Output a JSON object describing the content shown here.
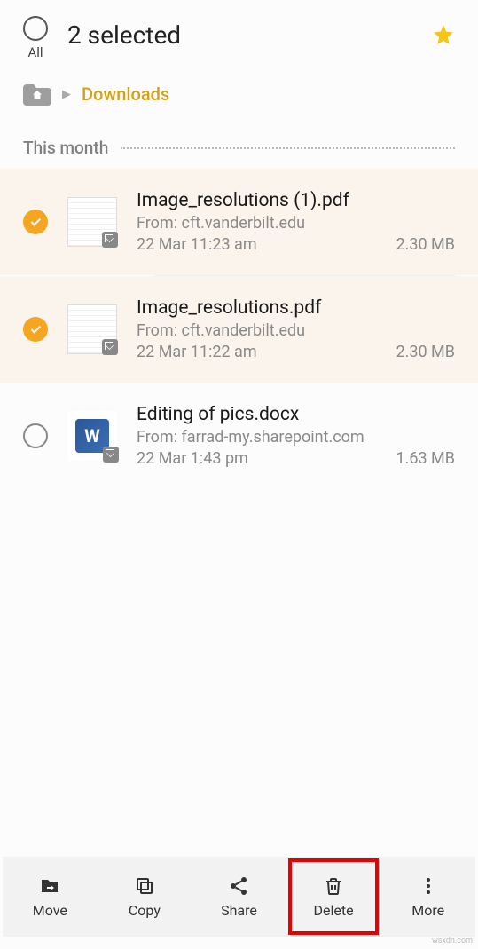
{
  "header": {
    "title": "2 selected",
    "select_all_label": "All"
  },
  "breadcrumb": {
    "current": "Downloads"
  },
  "section": {
    "title": "This month"
  },
  "files": [
    {
      "name": "Image_resolutions (1).pdf",
      "from": "From: cft.vanderbilt.edu",
      "date": "22 Mar 11:23 am",
      "size": "2.30 MB",
      "selected": true,
      "type": "pdf"
    },
    {
      "name": "Image_resolutions.pdf",
      "from": "From: cft.vanderbilt.edu",
      "date": "22 Mar 11:22 am",
      "size": "2.30 MB",
      "selected": true,
      "type": "pdf"
    },
    {
      "name": "Editing of pics.docx",
      "from": "From: farrad-my.sharepoint.com",
      "date": "22 Mar 1:43 pm",
      "size": "1.63 MB",
      "selected": false,
      "type": "docx"
    }
  ],
  "bottom_bar": {
    "move": "Move",
    "copy": "Copy",
    "share": "Share",
    "delete": "Delete",
    "more": "More"
  },
  "watermark": "wsxdn.com"
}
